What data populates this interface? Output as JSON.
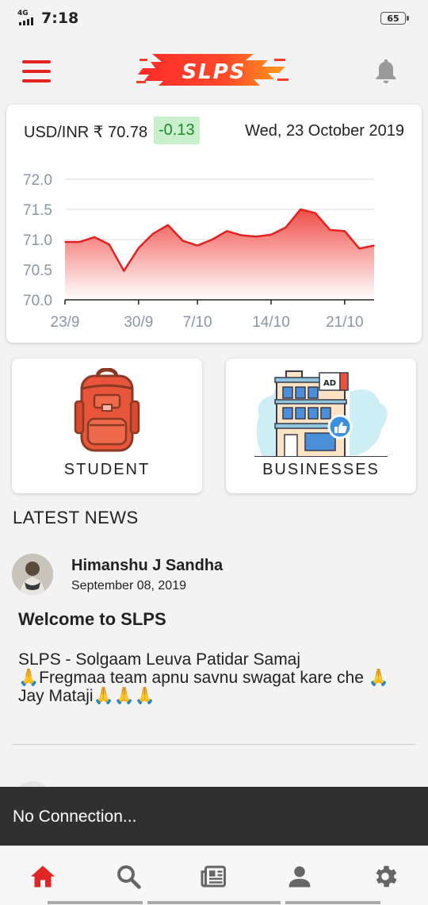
{
  "status_bar": {
    "network": "4G",
    "time": "7:18",
    "battery": "65"
  },
  "app_bar": {
    "logo_text": "SLPS",
    "menu_icon": "hamburger-menu-icon",
    "notification_icon": "bell-icon"
  },
  "rate_card": {
    "pair_label": "USD/INR ₹ 70.78",
    "change": "-0.13",
    "date": "Wed, 23 October 2019",
    "colors": {
      "line": "#e52020",
      "fill_top": "#f0443e",
      "change_bg": "#c8f0cc",
      "change_text": "#1f8a2c"
    }
  },
  "chart_data": {
    "type": "area",
    "x_tick_labels": [
      "23/9",
      "30/9",
      "7/10",
      "14/10",
      "21/10"
    ],
    "y_tick_labels": [
      "72.0",
      "71.5",
      "71.0",
      "70.5",
      "70.0"
    ],
    "ylim": [
      70.0,
      72.0
    ],
    "grid": true,
    "x": [
      "23/9",
      "24/9",
      "25/9",
      "26/9",
      "27/9",
      "30/9",
      "1/10",
      "3/10",
      "4/10",
      "7/10",
      "8/10",
      "9/10",
      "10/10",
      "11/10",
      "14/10",
      "15/10",
      "16/10",
      "17/10",
      "18/10",
      "21/10",
      "22/10",
      "23/10"
    ],
    "values": [
      70.96,
      70.96,
      71.04,
      70.92,
      70.48,
      70.86,
      71.1,
      71.24,
      70.98,
      70.9,
      71.0,
      71.14,
      71.07,
      71.05,
      71.08,
      71.2,
      71.5,
      71.44,
      71.16,
      71.14,
      70.85,
      70.9
    ]
  },
  "tiles": [
    {
      "label": "STUDENT",
      "icon": "backpack-icon"
    },
    {
      "label": "BUSINESSES",
      "icon": "building-icon"
    }
  ],
  "news": {
    "section_title": "LATEST NEWS",
    "posts": [
      {
        "author": "Himanshu J Sandha",
        "date": "September 08, 2019",
        "title": "Welcome to SLPS",
        "body_line1": "SLPS - Solgaam Leuva Patidar Samaj",
        "body_line2": "🙏Fregmaa team apnu savnu swagat kare che 🙏",
        "body_line3": "Jay Mataji🙏🙏🙏"
      }
    ]
  },
  "snackbar": {
    "message": "No Connection..."
  },
  "bottom_nav": [
    {
      "icon": "home-icon",
      "active": true
    },
    {
      "icon": "search-icon",
      "active": false
    },
    {
      "icon": "newspaper-icon",
      "active": false
    },
    {
      "icon": "profile-icon",
      "active": false
    },
    {
      "icon": "settings-gear-icon",
      "active": false
    }
  ]
}
